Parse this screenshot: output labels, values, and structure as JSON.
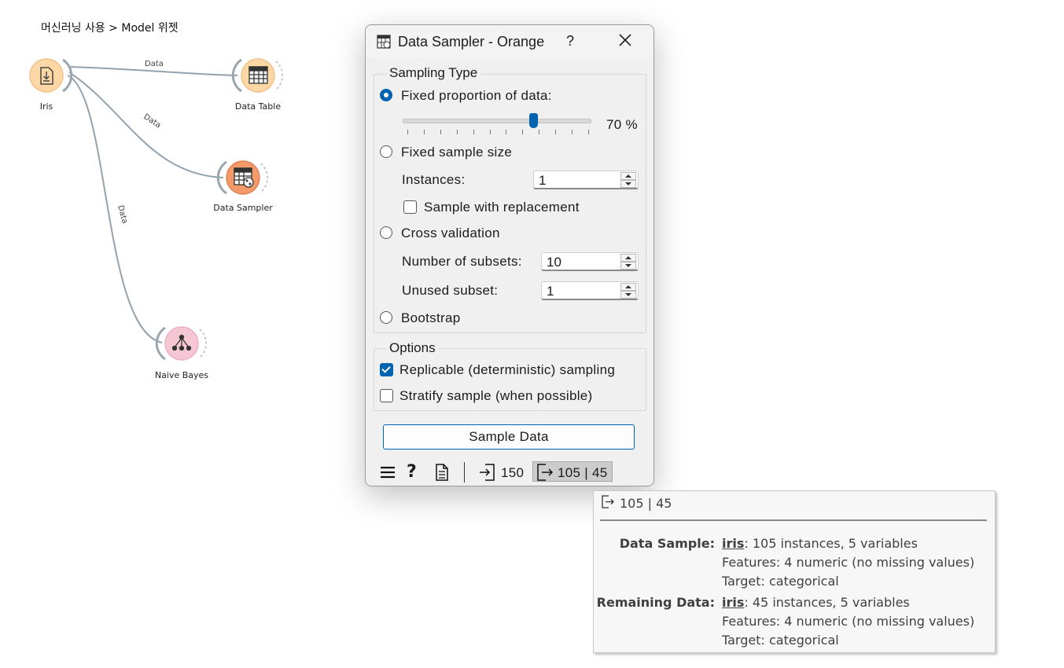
{
  "breadcrumb": "머신러닝 사용 > Model 위젯",
  "canvas": {
    "nodes": [
      {
        "label": "Iris"
      },
      {
        "label": "Data Table"
      },
      {
        "label": "Data Sampler"
      },
      {
        "label": "Naive Bayes"
      }
    ],
    "links": [
      {
        "label": "Data"
      },
      {
        "label": "Data"
      },
      {
        "label": "Data"
      }
    ]
  },
  "dialog": {
    "title": "Data Sampler - Orange",
    "help": "?",
    "sampling_type": {
      "title": "Sampling Type",
      "fixed_proportion": "Fixed proportion of data:",
      "proportion_value": "70 %",
      "proportion_fraction": 0.7,
      "fixed_size": "Fixed sample size",
      "instances_label": "Instances:",
      "instances_value": "1",
      "replacement": "Sample with replacement",
      "cross_validation": "Cross validation",
      "subsets_label": "Number of subsets:",
      "subsets_value": "10",
      "unused_label": "Unused subset:",
      "unused_value": "1",
      "bootstrap": "Bootstrap",
      "selected": "fixed_proportion"
    },
    "options": {
      "title": "Options",
      "replicable": "Replicable (deterministic) sampling",
      "replicable_checked": true,
      "stratify": "Stratify sample (when possible)",
      "stratify_checked": false
    },
    "sample_button": "Sample Data",
    "status": {
      "input_count": "150",
      "output_count": "105 | 45"
    }
  },
  "tooltip": {
    "header": "105 | 45",
    "data_sample_label": "Data Sample:",
    "data_sample_name": "iris",
    "data_sample_desc": ": 105 instances, 5 variables",
    "data_sample_features": "Features: 4 numeric (no missing values)",
    "data_sample_target": "Target: categorical",
    "remaining_label": "Remaining Data:",
    "remaining_name": "iris",
    "remaining_desc": ": 45 instances, 5 variables",
    "remaining_features": "Features: 4 numeric (no missing values)",
    "remaining_target": "Target: categorical"
  },
  "colors": {
    "accent": "#0063b1",
    "node_orange": "#fdd8a6",
    "node_sampler": "#f29a69",
    "node_pink": "#f5c6d4"
  }
}
